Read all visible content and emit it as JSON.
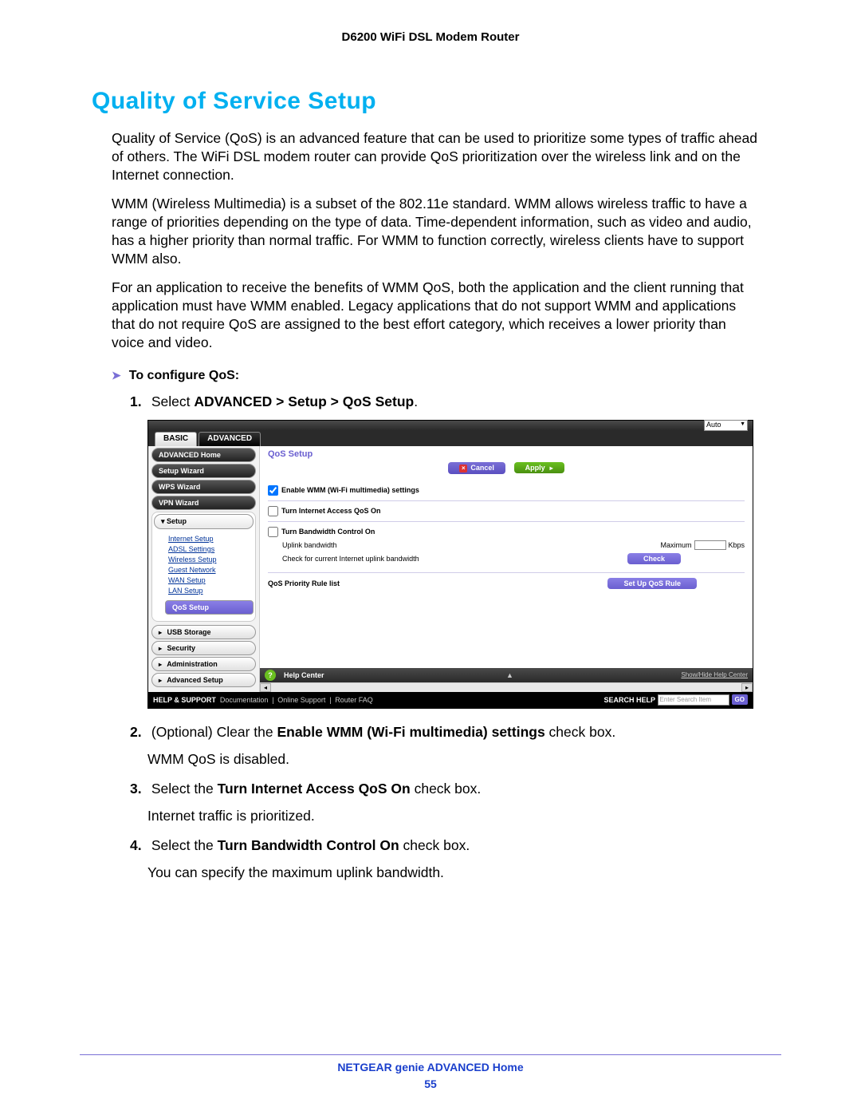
{
  "header": "D6200 WiFi DSL Modem Router",
  "h1": "Quality of Service Setup",
  "p1": "Quality of Service (QoS) is an advanced feature that can be used to prioritize some types of traffic ahead of others. The WiFi DSL modem router can provide QoS prioritization over the wireless link and on the Internet connection.",
  "p2": "WMM (Wireless Multimedia) is a subset of the 802.11e standard. WMM allows wireless traffic to have a range of priorities depending on the type of data. Time-dependent information, such as video and audio, has a higher priority than normal traffic. For WMM to function correctly, wireless clients have to support WMM also.",
  "p3": "For an application to receive the benefits of WMM QoS, both the application and the client running that application must have WMM enabled. Legacy applications that do not support WMM and applications that do not require QoS are assigned to the best effort category, which receives a lower priority than voice and video.",
  "config_head": "To configure QoS:",
  "steps": {
    "s1_pre": "Select ",
    "s1_bold": "ADVANCED > Setup > QoS Setup",
    "s1_post": ".",
    "s2_pre": "(Optional) Clear the ",
    "s2_bold": "Enable WMM (Wi-Fi multimedia) settings",
    "s2_post": " check box.",
    "s2_sub": "WMM QoS is disabled.",
    "s3_pre": "Select the ",
    "s3_bold": "Turn Internet Access QoS On",
    "s3_post": " check box.",
    "s3_sub": "Internet traffic is prioritized.",
    "s4_pre": "Select the ",
    "s4_bold": "Turn Bandwidth Control On",
    "s4_post": " check box.",
    "s4_sub": "You can specify the maximum uplink bandwidth."
  },
  "shot": {
    "auto": "Auto",
    "tabs": {
      "basic": "BASIC",
      "advanced": "ADVANCED"
    },
    "side": {
      "home": "ADVANCED Home",
      "setup_wiz": "Setup Wizard",
      "wps_wiz": "WPS Wizard",
      "vpn_wiz": "VPN Wizard",
      "setup": "Setup",
      "links": [
        "Internet Setup",
        "ADSL Settings",
        "Wireless Setup",
        "Guest Network",
        "WAN Setup",
        "LAN Setup"
      ],
      "qos": "QoS Setup",
      "usb": "USB Storage",
      "security": "Security",
      "admin": "Administration",
      "adv": "Advanced Setup"
    },
    "main": {
      "title": "QoS Setup",
      "cancel": "Cancel",
      "apply": "Apply",
      "wmm": "Enable WMM (Wi-Fi multimedia) settings",
      "internet": "Turn Internet Access QoS On",
      "bandwidth": "Turn Bandwidth Control On",
      "uplink": "Uplink bandwidth",
      "maximum": "Maximum",
      "kbps": "Kbps",
      "checkline": "Check for current Internet uplink bandwidth",
      "check": "Check",
      "rulelist": "QoS Priority Rule list",
      "setuprule": "Set Up QoS Rule"
    },
    "help": {
      "label": "Help Center",
      "showhide": "Show/Hide Help Center"
    },
    "footer": {
      "hs": "HELP & SUPPORT",
      "doc": "Documentation",
      "online": "Online Support",
      "faq": "Router FAQ",
      "search": "SEARCH HELP",
      "placeholder": "Enter Search Item",
      "go": "GO"
    }
  },
  "footer": {
    "title": "NETGEAR genie ADVANCED Home",
    "page": "55"
  }
}
